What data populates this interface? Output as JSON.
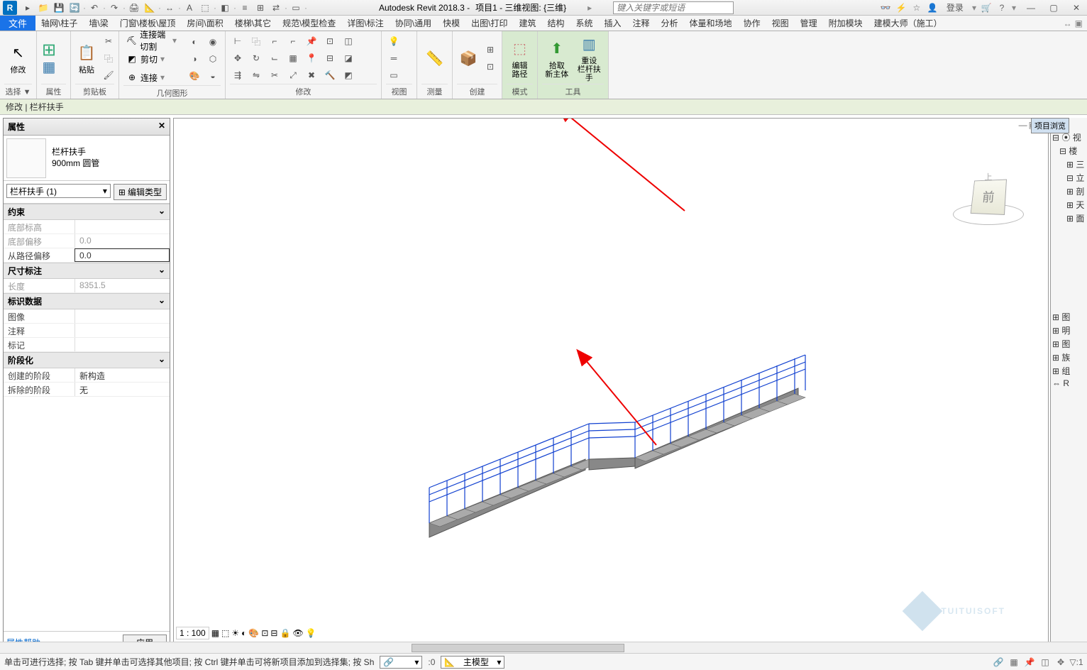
{
  "app": {
    "title": "Autodesk Revit 2018.3 -",
    "project": "项目1 - 三维视图: {三维}",
    "search_placeholder": "键入关键字或短语",
    "login": "登录"
  },
  "qat": [
    "open",
    "save",
    "sync",
    "undo",
    "redo",
    "dd",
    "print",
    "measure",
    "dim",
    "sep",
    "arc",
    "text",
    "extend",
    "3d",
    "section",
    "close",
    "thin",
    "switch",
    "sep2"
  ],
  "menu": {
    "file": "文件",
    "items": [
      "轴网\\柱子",
      "墙\\梁",
      "门窗\\楼板\\屋顶",
      "房间\\面积",
      "楼梯\\其它",
      "规范\\模型检查",
      "详图\\标注",
      "协同\\通用",
      "快模",
      "出图\\打印",
      "建筑",
      "结构",
      "系统",
      "插入",
      "注释",
      "分析",
      "体量和场地",
      "协作",
      "视图",
      "管理",
      "附加模块",
      "建模大师（施工）"
    ]
  },
  "ribbon": {
    "groups": {
      "select": "选择 ▼",
      "properties": "属性",
      "clipboard": "剪贴板",
      "geometry": "几何图形",
      "modify": "修改",
      "view": "视图",
      "measure": "测量",
      "create": "创建",
      "mode": "模式",
      "tools": "工具"
    },
    "modify_label": "修改",
    "paste": "粘贴",
    "cut_connect": "连接端切割",
    "cut": "剪切",
    "join": "连接",
    "edit_path": "编辑\n路径",
    "pick_host": "拾取\n新主体",
    "reset_rail": "重设\n栏杆扶手"
  },
  "context": "修改 | 栏杆扶手",
  "props": {
    "title": "属性",
    "type_name1": "栏杆扶手",
    "type_name2": "900mm 圆管",
    "instance": "栏杆扶手 (1)",
    "edit_type": "编辑类型",
    "groups": {
      "constraints": "约束",
      "dims": "尺寸标注",
      "identity": "标识数据",
      "phasing": "阶段化"
    },
    "rows": {
      "base_elev": {
        "label": "底部标高",
        "value": ""
      },
      "base_offset": {
        "label": "底部偏移",
        "value": "0.0"
      },
      "path_offset": {
        "label": "从路径偏移",
        "value": "0.0"
      },
      "length": {
        "label": "长度",
        "value": "8351.5"
      },
      "image": {
        "label": "图像",
        "value": ""
      },
      "comments": {
        "label": "注释",
        "value": ""
      },
      "mark": {
        "label": "标记",
        "value": ""
      },
      "phase_created": {
        "label": "创建的阶段",
        "value": "新构造"
      },
      "phase_demo": {
        "label": "拆除的阶段",
        "value": "无"
      }
    },
    "help": "属性帮助",
    "apply": "应用"
  },
  "viewcube": {
    "front": "前",
    "top": "上"
  },
  "browser": {
    "title": "项目浏览",
    "items": [
      "⊟ ⦿ 视",
      "  ⊟ 楼",
      "   ⊞ 三",
      "   ⊟ 立",
      "   ⊞ 剖",
      "   ⊞ 天",
      "   ⊞ 面",
      "",
      "",
      "⊞ 图",
      "⊞ 明",
      "⊞ 图",
      "⊞ 族",
      "⊞ 组",
      "⇔ R"
    ]
  },
  "viewctrl": {
    "scale": "1 : 100"
  },
  "status": {
    "hint": "单击可进行选择; 按 Tab 键并单击可选择其他项目; 按 Ctrl 键并单击可将新项目添加到选择集; 按 Sh",
    "combo1_val": "▾",
    "combo2_label": "主模型",
    "zero": ":0",
    "filter": "▾"
  },
  "watermark": "TUITUISOFT"
}
